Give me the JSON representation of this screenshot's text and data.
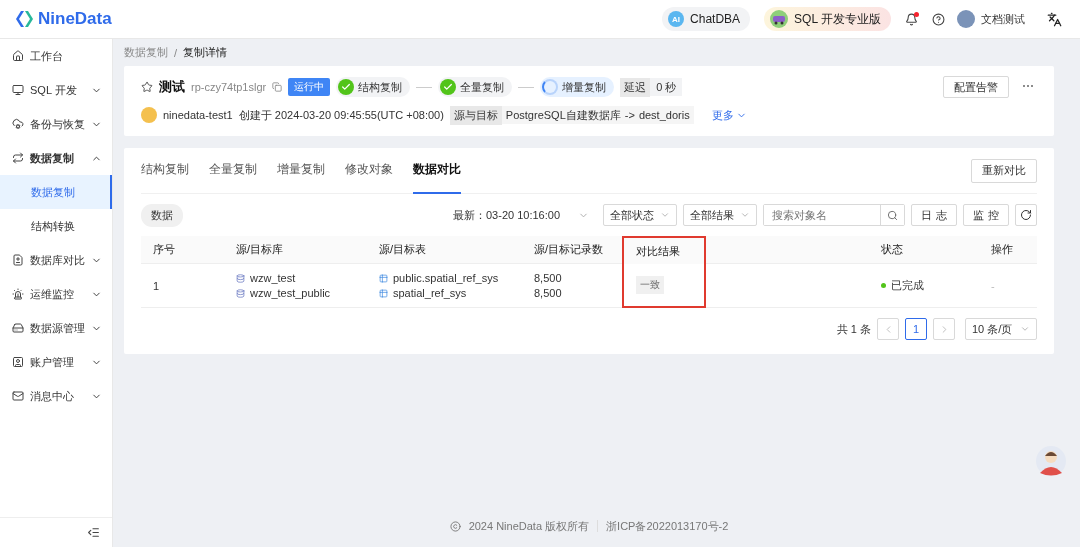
{
  "header": {
    "logo": "NineData",
    "chatdba": {
      "badge": "AI",
      "label": "ChatDBA"
    },
    "edition": "SQL 开发专业版",
    "notification_unread": true,
    "user": "文档测试"
  },
  "sidebar": {
    "items": [
      {
        "label": "工作台"
      },
      {
        "label": "SQL 开发",
        "expanded": false
      },
      {
        "label": "备份与恢复",
        "expanded": false
      },
      {
        "label": "数据复制",
        "expanded": true,
        "children": [
          {
            "label": "数据复制",
            "selected": true
          },
          {
            "label": "结构转换",
            "selected": false
          }
        ]
      },
      {
        "label": "数据库对比",
        "expanded": false
      },
      {
        "label": "运维监控",
        "expanded": false
      },
      {
        "label": "数据源管理",
        "expanded": false
      },
      {
        "label": "账户管理",
        "expanded": false
      },
      {
        "label": "消息中心",
        "expanded": false
      }
    ]
  },
  "breadcrumb": {
    "items": [
      "数据复制",
      "复制详情"
    ],
    "separator": "/"
  },
  "task": {
    "name": "测试",
    "id": "rp-czy74tp1slgr",
    "status": "运行中",
    "stages": [
      {
        "label": "结构复制",
        "kind": "done"
      },
      {
        "label": "全量复制",
        "kind": "done"
      },
      {
        "label": "增量复制",
        "kind": "running"
      }
    ],
    "delay_label": "延迟",
    "delay_value": "0 秒",
    "creator": "ninedata-test1",
    "created": "创建于 2024-03-20 09:45:55(UTC +08:00)",
    "route_label": "源与目标",
    "source": "PostgreSQL自建数据库",
    "arrow": "->",
    "target": "dest_doris",
    "more": "更多",
    "alert_button": "配置告警"
  },
  "tabs": [
    {
      "label": "结构复制",
      "selected": false
    },
    {
      "label": "全量复制",
      "selected": false
    },
    {
      "label": "增量复制",
      "selected": false
    },
    {
      "label": "修改对象",
      "selected": false
    },
    {
      "label": "数据对比",
      "selected": true
    }
  ],
  "recompare_button": "重新对比",
  "toolbar": {
    "chip": "数据",
    "latest": "最新：03-20 10:16:00",
    "status_filter": "全部状态",
    "result_filter": "全部结果",
    "search_placeholder": "搜索对象名",
    "log_button": "日 志",
    "monitor_button": "监 控"
  },
  "table": {
    "columns": [
      {
        "label": "序号",
        "highlighted": false
      },
      {
        "label": "源/目标库",
        "highlighted": false
      },
      {
        "label": "源/目标表",
        "highlighted": false
      },
      {
        "label": "源/目标记录数",
        "highlighted": false
      },
      {
        "label": "对比结果",
        "highlighted": true
      },
      {
        "highlighted": false
      },
      {
        "label": "状态",
        "highlighted": false
      },
      {
        "label": "操作",
        "highlighted": false
      }
    ],
    "rows": [
      {
        "index": "1",
        "databases": [
          "wzw_test",
          "wzw_test_public"
        ],
        "tables": [
          "public.spatial_ref_sys",
          "spatial_ref_sys"
        ],
        "counts": [
          "8,500",
          "8,500"
        ],
        "result": "一致",
        "status": "已完成",
        "color": "#52c41a",
        "action": "-"
      }
    ]
  },
  "pagination": {
    "total": "共 1 条",
    "pages": [
      {
        "label": "1",
        "selected": true
      }
    ],
    "page_size": "10 条/页"
  },
  "footer": {
    "copyright": "2024 NineData 版权所有",
    "icp": "浙ICP备2022013170号-2"
  }
}
